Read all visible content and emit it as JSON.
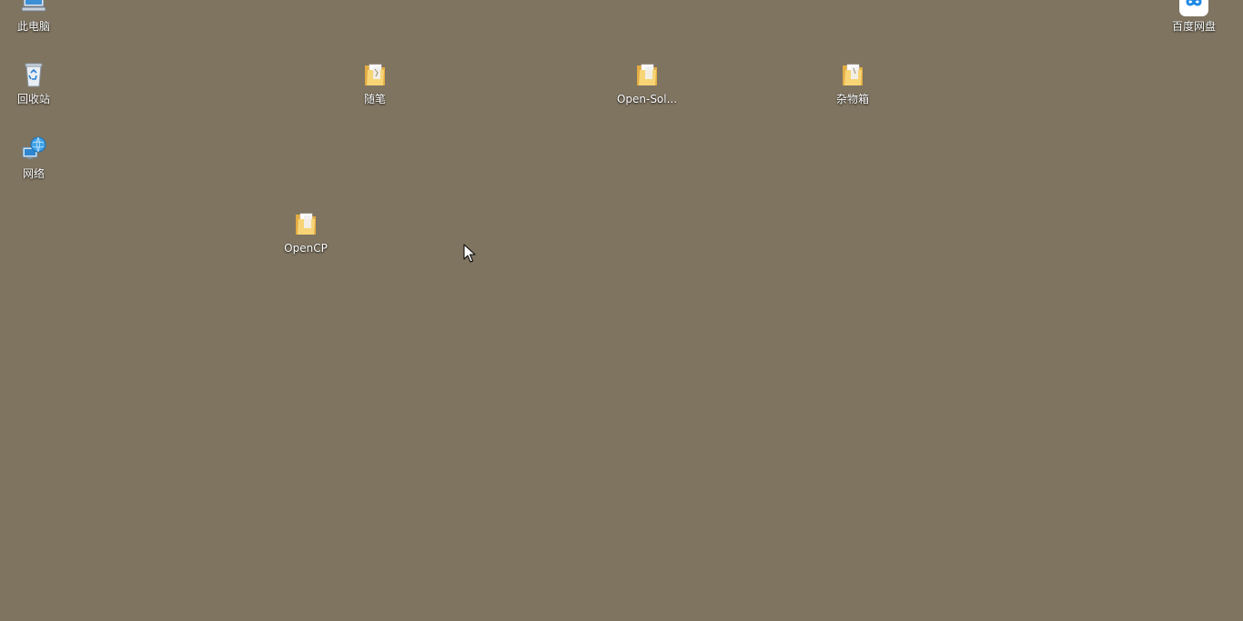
{
  "desktop": {
    "background_color": "#7f7460",
    "icons": [
      {
        "id": "this-pc",
        "label": "此电脑",
        "icon": "computer-icon"
      },
      {
        "id": "recycle",
        "label": "回收站",
        "icon": "recycle-bin-icon"
      },
      {
        "id": "network",
        "label": "网络",
        "icon": "network-globe-icon"
      },
      {
        "id": "suibi",
        "label": "随笔",
        "icon": "folder-icon"
      },
      {
        "id": "opensol",
        "label": "Open-Sol...",
        "icon": "folder-icon"
      },
      {
        "id": "zawu",
        "label": "杂物箱",
        "icon": "folder-icon"
      },
      {
        "id": "opencp",
        "label": "OpenCP",
        "icon": "folder-icon"
      },
      {
        "id": "baidu",
        "label": "百度网盘",
        "icon": "baidu-netdisk-icon"
      }
    ]
  },
  "colors": {
    "folder_back": "#e8b54a",
    "folder_front": "#f8d878",
    "paper": "#ffffff",
    "label_text": "#ffffff",
    "baidu_blue": "#1e88e5"
  }
}
